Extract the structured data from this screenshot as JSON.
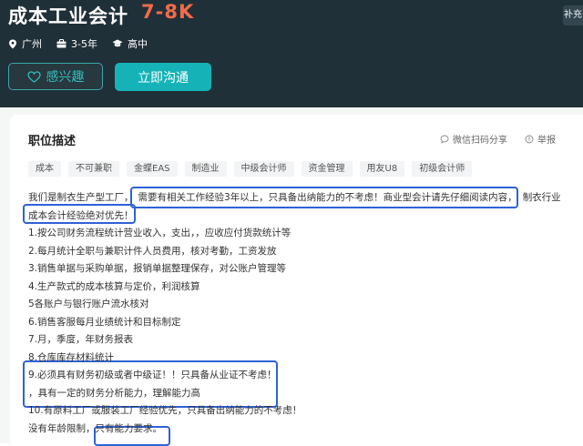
{
  "header": {
    "job_title": "成本工业会计",
    "salary": "7-8K",
    "corner_badge": "补充",
    "location": "广州",
    "experience": "3-5年",
    "education": "高中",
    "interest_label": "感兴趣",
    "chat_label": "立即沟通"
  },
  "card": {
    "title": "职位描述",
    "share_label": "微信扫码分享",
    "report_label": "举报",
    "tags": [
      "成本",
      "不可兼职",
      "金蝶EAS",
      "制造业",
      "中级会计师",
      "资金管理",
      "用友U8",
      "初级会计师"
    ]
  },
  "description": {
    "l1a": "我们是制衣生产型工厂，",
    "l1b": "需要有相关工作经验3年以上，只具备出纳能力的不考虑！商业型会计请先仔细阅读内容，",
    "l1c": "制衣行业",
    "l2": "成本会计经验绝对优先！",
    "l3": "1.按公司财务流程统计营业收入，支出，，应收应付货款统计等",
    "l4": "2.每月统计全职与兼职计件人员费用，核对考勤，工资发放",
    "l5": "3.销售单据与采购单据，报销单据整理保存，对公账户管理等",
    "l6": "4.生产款式的成本核算与定价，利润核算",
    "l7": "5各账户与银行账户流水核对",
    "l8": "6.销售客服每月业绩统计和目标制定",
    "l9": "7.月，季度，年财务报表",
    "l10": "8.仓库库存材料统计",
    "l11": "9.必须具有财务初级或者中级证！！只具备从业证不考虑！",
    "l12": "，具有一定的财务分析能力，理解能力高",
    "l13": "10.有原料工厂或服装工厂经验优先，只具备出纳能力的不考虑！",
    "l14a": "没有年龄限制，",
    "l14b": "只有能力要求。"
  },
  "colors": {
    "header_bg": "#203038",
    "salary": "#f26b4a",
    "accent": "#15b3b8",
    "highlight_box": "#2f62d6"
  }
}
